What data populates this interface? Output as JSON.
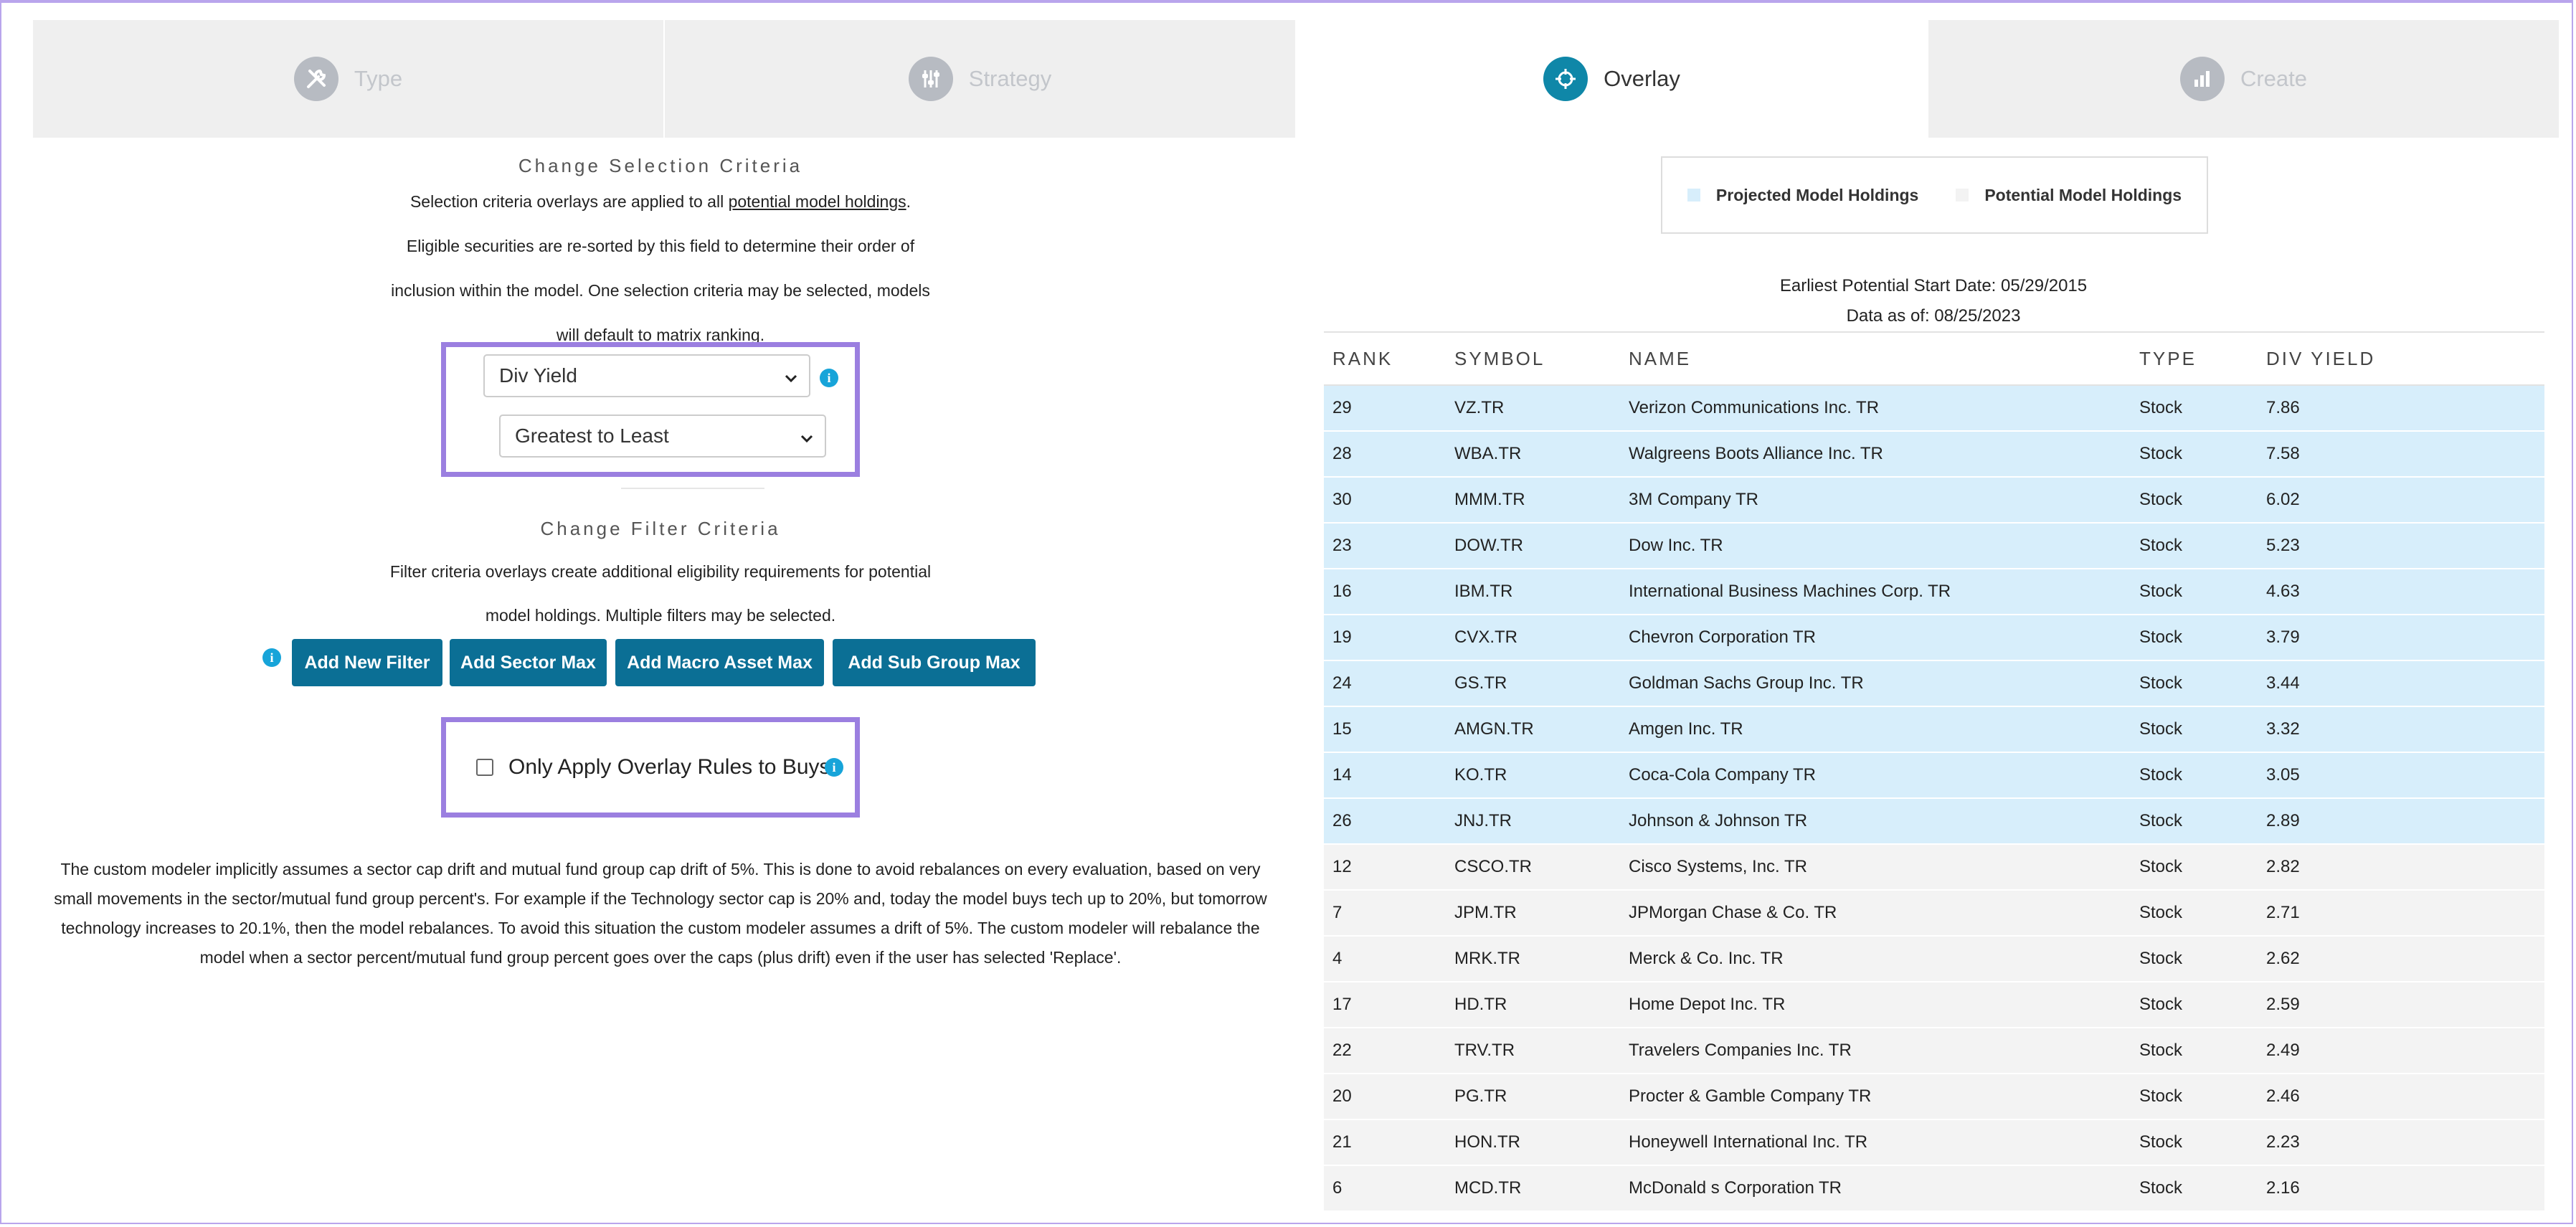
{
  "tabs": [
    {
      "label": "Type",
      "icon": "tools-icon",
      "active": false
    },
    {
      "label": "Strategy",
      "icon": "sliders-icon",
      "active": false
    },
    {
      "label": "Overlay",
      "icon": "target-icon",
      "active": true
    },
    {
      "label": "Create",
      "icon": "bar-chart-icon",
      "active": false
    }
  ],
  "selection": {
    "title": "Change Selection Criteria",
    "para1_pre": "Selection criteria overlays are applied to all ",
    "para1_link": "potential model holdings",
    "para1_post": ".",
    "para2": "Eligible securities are re-sorted by this field to determine their order of",
    "para3": "inclusion within the model. One selection criteria may be selected, models",
    "para4": "will default to matrix ranking.",
    "field_value": "Div Yield",
    "order_value": "Greatest to Least"
  },
  "filter": {
    "title": "Change Filter Criteria",
    "para1": "Filter criteria overlays create additional eligibility requirements for potential",
    "para2": "model holdings. Multiple filters may be selected.",
    "buttons": [
      "Add New Filter",
      "Add Sector Max",
      "Add Macro Asset Max",
      "Add Sub Group Max"
    ],
    "checkbox_label": "Only Apply Overlay Rules to Buys"
  },
  "note": "The custom modeler implicitly assumes a sector cap drift and mutual fund group cap drift of 5%. This is done to avoid rebalances on every evaluation, based on very small movements in the sector/mutual fund group percent's. For example if the Technology sector cap is 20% and, today the model buys tech up to 20%, but tomorrow technology increases to 20.1%, then the model rebalances. To avoid this situation the custom modeler assumes a drift of 5%. The custom modeler will rebalance the model when a sector percent/mutual fund group percent goes over the caps (plus drift) even if the user has selected 'Replace'.",
  "legend": {
    "projected": "Projected Model Holdings",
    "potential": "Potential Model Holdings",
    "projected_color": "#d7eefb",
    "potential_color": "#f3f3f3"
  },
  "dates": {
    "start": "Earliest Potential Start Date: 05/29/2015",
    "asof": "Data as of: 08/25/2023"
  },
  "table": {
    "headers": [
      "RANK",
      "SYMBOL",
      "NAME",
      "TYPE",
      "DIV YIELD"
    ],
    "rows": [
      {
        "rank": "29",
        "symbol": "VZ.TR",
        "name": "Verizon Communications Inc. TR",
        "type": "Stock",
        "div": "7.86",
        "group": "proj"
      },
      {
        "rank": "28",
        "symbol": "WBA.TR",
        "name": "Walgreens Boots Alliance Inc. TR",
        "type": "Stock",
        "div": "7.58",
        "group": "proj"
      },
      {
        "rank": "30",
        "symbol": "MMM.TR",
        "name": "3M Company TR",
        "type": "Stock",
        "div": "6.02",
        "group": "proj"
      },
      {
        "rank": "23",
        "symbol": "DOW.TR",
        "name": "Dow Inc. TR",
        "type": "Stock",
        "div": "5.23",
        "group": "proj"
      },
      {
        "rank": "16",
        "symbol": "IBM.TR",
        "name": "International Business Machines Corp. TR",
        "type": "Stock",
        "div": "4.63",
        "group": "proj"
      },
      {
        "rank": "19",
        "symbol": "CVX.TR",
        "name": "Chevron Corporation TR",
        "type": "Stock",
        "div": "3.79",
        "group": "proj"
      },
      {
        "rank": "24",
        "symbol": "GS.TR",
        "name": "Goldman Sachs Group Inc. TR",
        "type": "Stock",
        "div": "3.44",
        "group": "proj"
      },
      {
        "rank": "15",
        "symbol": "AMGN.TR",
        "name": "Amgen Inc. TR",
        "type": "Stock",
        "div": "3.32",
        "group": "proj"
      },
      {
        "rank": "14",
        "symbol": "KO.TR",
        "name": "Coca-Cola Company TR",
        "type": "Stock",
        "div": "3.05",
        "group": "proj"
      },
      {
        "rank": "26",
        "symbol": "JNJ.TR",
        "name": "Johnson & Johnson TR",
        "type": "Stock",
        "div": "2.89",
        "group": "proj"
      },
      {
        "rank": "12",
        "symbol": "CSCO.TR",
        "name": "Cisco Systems, Inc. TR",
        "type": "Stock",
        "div": "2.82",
        "group": "pot"
      },
      {
        "rank": "7",
        "symbol": "JPM.TR",
        "name": "JPMorgan Chase & Co. TR",
        "type": "Stock",
        "div": "2.71",
        "group": "pot"
      },
      {
        "rank": "4",
        "symbol": "MRK.TR",
        "name": "Merck & Co. Inc. TR",
        "type": "Stock",
        "div": "2.62",
        "group": "pot"
      },
      {
        "rank": "17",
        "symbol": "HD.TR",
        "name": "Home Depot Inc. TR",
        "type": "Stock",
        "div": "2.59",
        "group": "pot"
      },
      {
        "rank": "22",
        "symbol": "TRV.TR",
        "name": "Travelers Companies Inc. TR",
        "type": "Stock",
        "div": "2.49",
        "group": "pot"
      },
      {
        "rank": "20",
        "symbol": "PG.TR",
        "name": "Procter & Gamble Company TR",
        "type": "Stock",
        "div": "2.46",
        "group": "pot"
      },
      {
        "rank": "21",
        "symbol": "HON.TR",
        "name": "Honeywell International Inc. TR",
        "type": "Stock",
        "div": "2.23",
        "group": "pot"
      },
      {
        "rank": "6",
        "symbol": "MCD.TR",
        "name": "McDonald s Corporation TR",
        "type": "Stock",
        "div": "2.16",
        "group": "pot"
      }
    ]
  }
}
